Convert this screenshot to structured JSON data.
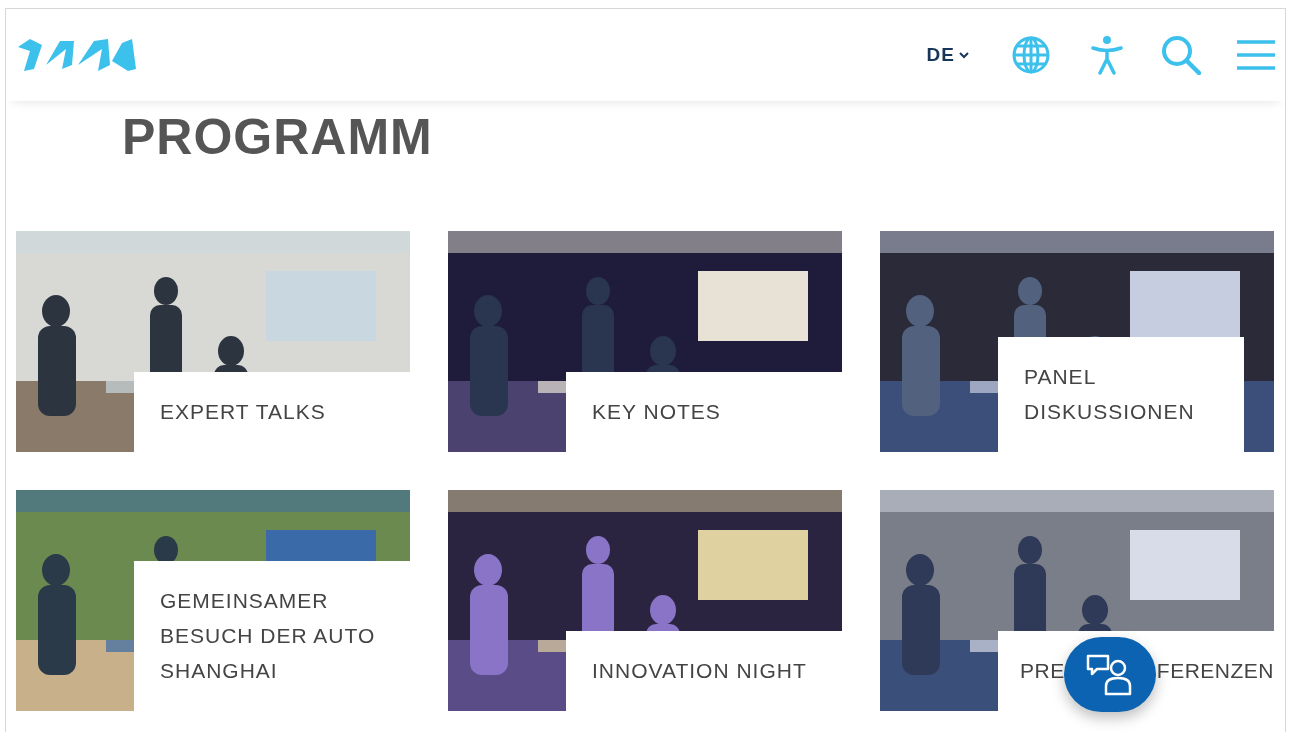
{
  "header": {
    "language": "DE"
  },
  "page_title": "PROGRAMM",
  "cards": [
    {
      "title_parts": [
        "EXPERT TALKS"
      ],
      "photo": {
        "kind": "picture"
      }
    },
    {
      "title_parts": [
        "KEY NOTES"
      ],
      "photo": {
        "kind": "picture"
      }
    },
    {
      "title_parts": [
        "PANEL DISKUSSIONEN"
      ],
      "photo": {
        "kind": "picture"
      }
    },
    {
      "title_parts": [
        "GEMEINSAMER BESUCH DER AUTO SHANGHAI"
      ],
      "photo": {
        "kind": "picture"
      }
    },
    {
      "title_parts": [
        "INNOVATION NIGHT"
      ],
      "photo": {
        "kind": "picture"
      }
    },
    {
      "title_parts": [
        "PRE",
        "FERENZEN"
      ],
      "photo": {
        "kind": "picture"
      }
    }
  ]
}
